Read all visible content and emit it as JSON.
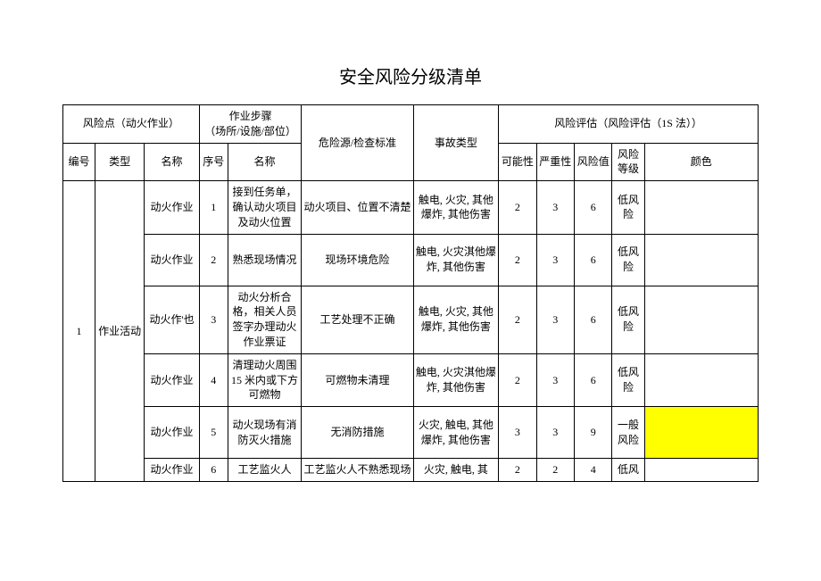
{
  "title": "安全风险分级清单",
  "header": {
    "riskPoint": "风险点（动火作业）",
    "stepGroup": "作业步骤\n（场所/设施/部位）",
    "hazard": "危险源/检查标准",
    "accident": "事故类型",
    "evalGroup": "风险评估（风险评估（1S 法））",
    "no": "编号",
    "type": "类型",
    "name": "名称",
    "seq": "序号",
    "stepName": "名称",
    "poss": "可能性",
    "sev": "严重性",
    "val": "风险值",
    "level": "风险等级",
    "color": "颜色"
  },
  "group": {
    "no": "1",
    "type": "作业活动",
    "name": "动火作'也"
  },
  "rows": [
    {
      "rname": "动火作业",
      "seq": "1",
      "step": "接到任务单，确认动火项目及动火位置",
      "hazard": "动火项目、位置不清楚",
      "accident": "触电, 火灾, 其他爆炸, 其他伤害",
      "poss": "2",
      "sev": "3",
      "val": "6",
      "level": "低风险",
      "yellow": false
    },
    {
      "rname": "动火作业",
      "seq": "2",
      "step": "熟悉现场情况",
      "hazard": "现场环境危险",
      "accident": "触电, 火灾淇他爆炸, 其他伤害",
      "poss": "2",
      "sev": "3",
      "val": "6",
      "level": "低风险",
      "yellow": false
    },
    {
      "rname": "",
      "seq": "3",
      "step": "动火分析合格，相关人员签字办理动火作业票证",
      "hazard": "工艺处理不正确",
      "accident": "触电, 火灾, 其他爆炸, 其他伤害",
      "poss": "2",
      "sev": "3",
      "val": "6",
      "level": "低风险",
      "yellow": false
    },
    {
      "rname": "动火作业",
      "seq": "4",
      "step": "清理动火周围 15 米内或下方可燃物",
      "hazard": "可燃物未清理",
      "accident": "触电, 火灾淇他爆炸, 其他伤害",
      "poss": "2",
      "sev": "3",
      "val": "6",
      "level": "低风险",
      "yellow": false
    },
    {
      "rname": "动火作业",
      "seq": "5",
      "step": "动火现场有消防灭火措施",
      "hazard": "无消防措施",
      "accident": "火灾, 触电, 其他爆炸, 其他伤害",
      "poss": "3",
      "sev": "3",
      "val": "9",
      "level": "一般风险",
      "yellow": true
    },
    {
      "rname": "动火作业",
      "seq": "6",
      "step": "工艺监火人",
      "hazard": "工艺监火人不熟悉现场",
      "accident": "火灾, 触电, 其",
      "poss": "2",
      "sev": "2",
      "val": "4",
      "level": "低风",
      "yellow": false
    }
  ]
}
